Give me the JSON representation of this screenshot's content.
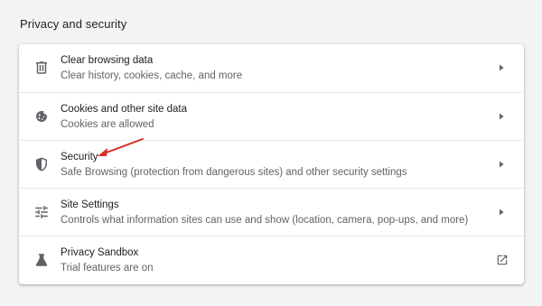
{
  "section": {
    "title": "Privacy and security"
  },
  "items": [
    {
      "icon": "trash-icon",
      "label": "Clear browsing data",
      "sublabel": "Clear history, cookies, cache, and more",
      "action": "chevron"
    },
    {
      "icon": "cookie-icon",
      "label": "Cookies and other site data",
      "sublabel": "Cookies are allowed",
      "action": "chevron"
    },
    {
      "icon": "shield-icon",
      "label": "Security",
      "sublabel": "Safe Browsing (protection from dangerous sites) and other security settings",
      "action": "chevron"
    },
    {
      "icon": "sliders-icon",
      "label": "Site Settings",
      "sublabel": "Controls what information sites can use and show (location, camera, pop-ups, and more)",
      "action": "chevron"
    },
    {
      "icon": "flask-icon",
      "label": "Privacy Sandbox",
      "sublabel": "Trial features are on",
      "action": "external-link"
    }
  ],
  "colors": {
    "background": "#f1f3f4",
    "card": "#ffffff",
    "primary_text": "#202124",
    "secondary_text": "#5f6368",
    "icon": "#5f6368",
    "annotation_arrow": "#d93025"
  }
}
